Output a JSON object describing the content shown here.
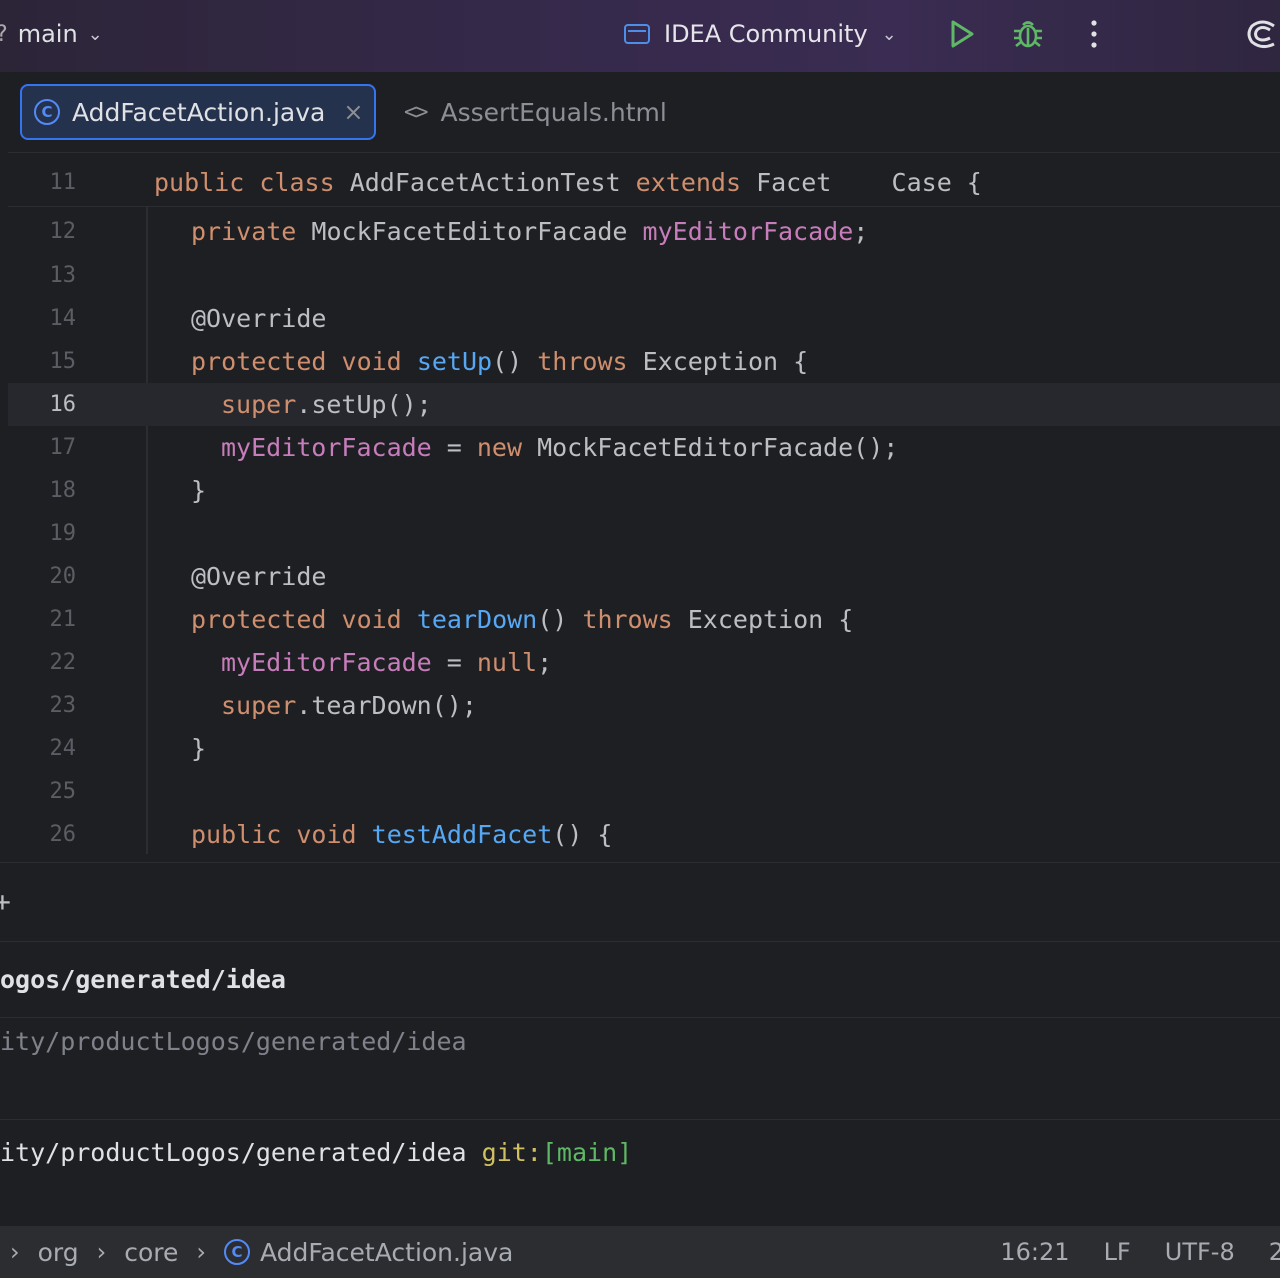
{
  "titlebar": {
    "branch_edge": "?",
    "branch": "main",
    "run_config": "IDEA Community"
  },
  "tabs": [
    {
      "label": "AddFacetAction.java",
      "close": "×"
    },
    {
      "label": "AssertEquals.html",
      "icon": "<>"
    }
  ],
  "code": {
    "sticky": {
      "num": "11",
      "text": [
        "public",
        " ",
        "class",
        " AddFacetActionTest ",
        "extends",
        " Facet    ",
        "Case {"
      ]
    },
    "lines": [
      {
        "num": "12"
      },
      {
        "num": "13"
      },
      {
        "num": "14"
      },
      {
        "num": "15"
      },
      {
        "num": "16"
      },
      {
        "num": "17"
      },
      {
        "num": "18"
      },
      {
        "num": "19"
      },
      {
        "num": "20"
      },
      {
        "num": "21"
      },
      {
        "num": "22"
      },
      {
        "num": "23"
      },
      {
        "num": "24"
      },
      {
        "num": "25"
      },
      {
        "num": "26"
      }
    ],
    "t12": [
      "private",
      " MockFacetEditorFacade ",
      "myEditorFacade",
      ";"
    ],
    "t14": "@Override",
    "t15": [
      "protected",
      " ",
      "void",
      " ",
      "setUp",
      "() ",
      "throws",
      " Exception {"
    ],
    "t16": [
      "super",
      ".setUp();"
    ],
    "t17": [
      "myEditorFacade",
      " = ",
      "new",
      " MockFacetEditorFacade();"
    ],
    "t18": "}",
    "t20": "@Override",
    "t21": [
      "protected",
      " ",
      "void",
      " ",
      "tearDown",
      "() ",
      "throws",
      " Exception {"
    ],
    "t22": [
      "myEditorFacade",
      " = ",
      "null",
      ";"
    ],
    "t23": [
      "super",
      ".tearDown();"
    ],
    "t24": "}",
    "t26": [
      "public",
      " ",
      "void",
      " ",
      "testAddFacet",
      "() {"
    ]
  },
  "terminal": {
    "plus": "+",
    "line1": "ogos/generated/idea",
    "line2": "ity/productLogos/generated/idea",
    "line3_path": "ity/productLogos/generated/idea",
    "line3_git": "git:",
    "line3_branch": "[main]"
  },
  "statusbar": {
    "crumbs": [
      "org",
      "core",
      "AddFacetAction.java"
    ],
    "position": "16:21",
    "line_sep": "LF",
    "encoding": "UTF-8",
    "indent": "2"
  },
  "colors": {
    "keyword": "#cf8e6d",
    "field": "#c77dbb",
    "method": "#56a8f5",
    "annotation": "#b3ae60",
    "accent": "#3574f0"
  }
}
